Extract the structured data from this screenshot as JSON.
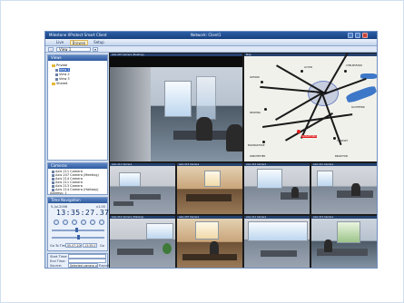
{
  "app": {
    "title": "Milestone XProtect Smart Client",
    "window_title": "Network: Client1",
    "tabs": [
      {
        "label": "Live"
      },
      {
        "label": "Browse"
      },
      {
        "label": "Setup"
      }
    ],
    "view_selector": "View 1"
  },
  "sidebar": {
    "views_title": "Views",
    "tree": [
      {
        "label": "Private",
        "type": "folder"
      },
      {
        "label": "View 1",
        "type": "camera",
        "selected": true
      },
      {
        "label": "View 2",
        "type": "camera"
      },
      {
        "label": "View 3",
        "type": "camera"
      },
      {
        "label": "Shared",
        "type": "folder"
      }
    ],
    "cameras_title": "Cameras",
    "camera_rows": [
      "Axis 211 Camera",
      "Axis 207 Camera (Meeting)",
      "Axis 214 Camera",
      "Axis 211 Camera",
      "Axis 213 Camera",
      "Axis 214 Camera (Hallway)"
    ],
    "camera_status": "Address: 1",
    "time_nav": {
      "title": "Time Navigation",
      "date_label": "5-Jul-2006",
      "speed_label": "x1.00",
      "time": "13:35:27.379",
      "goto_label": "Go To Time:",
      "goto_date": "05-07-2006",
      "goto_time": "13:35:27",
      "go_label": "Go"
    },
    "export": {
      "start_label": "Start Time:",
      "end_label": "End Time:",
      "source_label": "Source:",
      "source_value": "Selected camera only",
      "button_label": "Export"
    }
  },
  "cameras": [
    {
      "label": "Axis 207 Camera (Meeting)"
    },
    {
      "label": "Map"
    },
    {
      "label": "Axis 211 Camera"
    },
    {
      "label": "Axis 213 Camera"
    },
    {
      "label": "Axis 214 Camera"
    },
    {
      "label": "Axis 211 Camera"
    },
    {
      "label": "Axis 214 Camera (Hallway)"
    },
    {
      "label": "Axis 207 Camera"
    },
    {
      "label": "Axis 211 Camera"
    },
    {
      "label": "Axis 213 Camera"
    }
  ],
  "map": {
    "cities": [
      "LUTON",
      "OXFORD",
      "LONDON",
      "GUILDFORD",
      "READING",
      "BASINGSTOKE",
      "WINCHESTER",
      "CHELMSFORD",
      "BRIGHTON",
      "CRAWLEY",
      "SOUTHEND"
    ],
    "marker": "GUILDFORD"
  },
  "colors": {
    "titlebar": "#17407e",
    "accent": "#2e5a9e",
    "active_tab": "#fff3cf",
    "marker": "#e01c1c"
  }
}
